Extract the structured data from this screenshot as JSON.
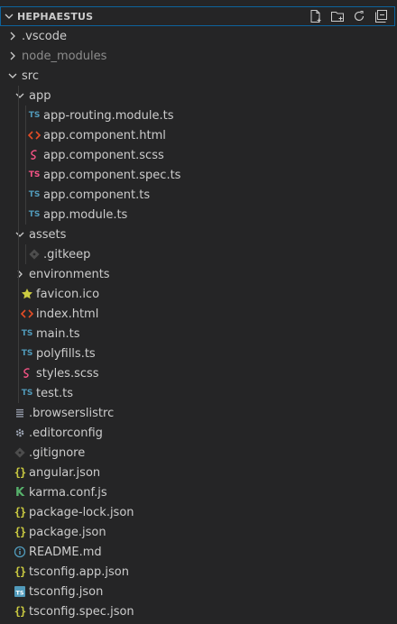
{
  "explorer": {
    "title": "HEPHAESTUS",
    "actions": [
      "new-file-icon",
      "new-folder-icon",
      "refresh-icon",
      "collapse-all-icon"
    ]
  },
  "tree": [
    {
      "label": ".vscode",
      "kind": "folder",
      "open": false,
      "depth": 1
    },
    {
      "label": "node_modules",
      "kind": "folder",
      "open": false,
      "depth": 1,
      "dim": true
    },
    {
      "label": "src",
      "kind": "folder",
      "open": true,
      "depth": 1
    },
    {
      "label": "app",
      "kind": "folder",
      "open": true,
      "depth": 2
    },
    {
      "label": "app-routing.module.ts",
      "kind": "ts",
      "depth": 3
    },
    {
      "label": "app.component.html",
      "kind": "html",
      "depth": 3
    },
    {
      "label": "app.component.scss",
      "kind": "scss",
      "depth": 3
    },
    {
      "label": "app.component.spec.ts",
      "kind": "spec",
      "depth": 3
    },
    {
      "label": "app.component.ts",
      "kind": "ts",
      "depth": 3
    },
    {
      "label": "app.module.ts",
      "kind": "ts",
      "depth": 3
    },
    {
      "label": "assets",
      "kind": "folder",
      "open": true,
      "depth": 2
    },
    {
      "label": ".gitkeep",
      "kind": "git",
      "depth": 3
    },
    {
      "label": "environments",
      "kind": "folder",
      "open": false,
      "depth": 2
    },
    {
      "label": "favicon.ico",
      "kind": "star",
      "depth": 2
    },
    {
      "label": "index.html",
      "kind": "html",
      "depth": 2
    },
    {
      "label": "main.ts",
      "kind": "ts",
      "depth": 2
    },
    {
      "label": "polyfills.ts",
      "kind": "ts",
      "depth": 2
    },
    {
      "label": "styles.scss",
      "kind": "scss",
      "depth": 2
    },
    {
      "label": "test.ts",
      "kind": "ts",
      "depth": 2
    },
    {
      "label": ".browserslistrc",
      "kind": "lines",
      "depth": 1
    },
    {
      "label": ".editorconfig",
      "kind": "gear",
      "depth": 1
    },
    {
      "label": ".gitignore",
      "kind": "git",
      "depth": 1
    },
    {
      "label": "angular.json",
      "kind": "json",
      "depth": 1
    },
    {
      "label": "karma.conf.js",
      "kind": "karma",
      "depth": 1
    },
    {
      "label": "package-lock.json",
      "kind": "json",
      "depth": 1
    },
    {
      "label": "package.json",
      "kind": "json",
      "depth": 1
    },
    {
      "label": "README.md",
      "kind": "info",
      "depth": 1
    },
    {
      "label": "tsconfig.app.json",
      "kind": "json",
      "depth": 1
    },
    {
      "label": "tsconfig.json",
      "kind": "tsconfig",
      "depth": 1
    },
    {
      "label": "tsconfig.spec.json",
      "kind": "json",
      "depth": 1
    }
  ],
  "colors": {
    "background": "#252526",
    "focus_border": "#0e639c",
    "text": "#cccccc",
    "dim_text": "#8c8c8c",
    "ts_blue": "#519aba",
    "spec_pink": "#f55385",
    "html_orange": "#e44d26",
    "scss_pink": "#f55385",
    "json_yellow": "#cbcb41",
    "star_yellow": "#cbcb41",
    "karma_green": "#56b06b",
    "info_blue": "#519aba"
  }
}
